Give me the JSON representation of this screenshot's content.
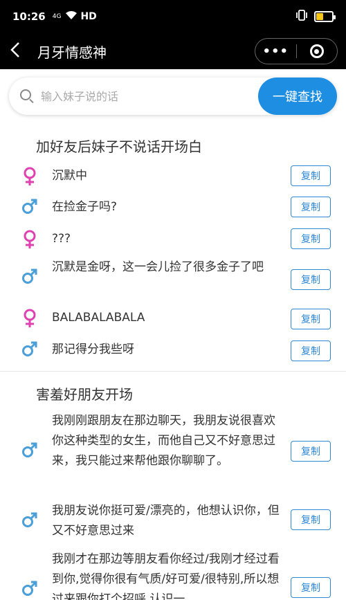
{
  "status": {
    "time": "10:26",
    "net": "4G",
    "hd": "HD"
  },
  "nav": {
    "title": "月牙情感神",
    "back": "<",
    "more": "•••"
  },
  "search": {
    "placeholder": "输入妹子说的话",
    "button": "一键查找"
  },
  "sections": [
    {
      "title": "加好友后妹子不说话开场白",
      "items": [
        {
          "gender": "female",
          "text": "沉默中",
          "copy": "复制"
        },
        {
          "gender": "male",
          "text": "在捡金子吗?",
          "copy": "复制"
        },
        {
          "gender": "female",
          "text": "???",
          "copy": "复制"
        },
        {
          "gender": "male",
          "text": "沉默是金呀，这一会儿捡了很多金子了吧",
          "copy": "复制"
        },
        {
          "gender": "female",
          "text": "BALABALABALA",
          "copy": "复制"
        },
        {
          "gender": "male",
          "text": "那记得分我些呀",
          "copy": "复制"
        }
      ]
    },
    {
      "title": "害羞好朋友开场",
      "items": [
        {
          "gender": "male",
          "text": "我刚刚跟朋友在那边聊天，我朋友说很喜欢你这种类型的女生，而他自己又不好意思过来，我只能过来帮他跟你聊聊了。",
          "copy": "复制"
        },
        {
          "gender": "male",
          "text": "我朋友说你挺可爱/漂亮的，他想认识你，但又不好意思过来",
          "copy": "复制"
        },
        {
          "gender": "male",
          "text": "我刚才在那边等朋友看你经过/我刚才经过看到你,觉得你很有气质/好可爱/很特别,所以想过来跟你打个招呼,认识一",
          "copy": "复制"
        }
      ]
    }
  ],
  "colors": {
    "female": "#e040b0",
    "male": "#4a9fd8",
    "accent": "#1e8ee3"
  }
}
